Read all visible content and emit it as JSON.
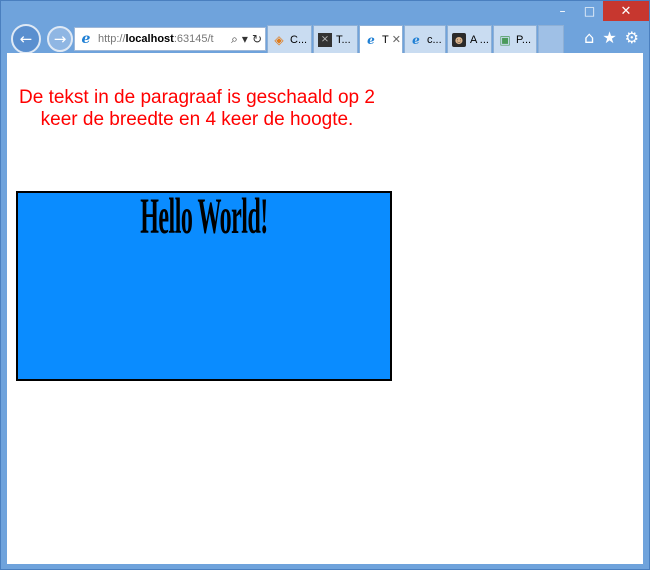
{
  "window": {
    "minimize": "–",
    "maximize": "□",
    "close": "✕"
  },
  "nav": {
    "back": "←",
    "forward": "→"
  },
  "address": {
    "prefix": "http://",
    "host": "localhost",
    "rest": ":63145/t"
  },
  "tabs": [
    {
      "label": "C...",
      "icon": "vs-icon"
    },
    {
      "label": "T...",
      "icon": "terminal-icon"
    },
    {
      "label": "T",
      "icon": "ie-icon",
      "active": true,
      "close": "✕"
    },
    {
      "label": "c...",
      "icon": "ie-icon"
    },
    {
      "label": "A ...",
      "icon": "avatar-icon"
    },
    {
      "label": "P...",
      "icon": "package-icon"
    }
  ],
  "page": {
    "paragraph": "De tekst in de paragraaf is geschaald op 2 keer de breedte en 4 keer de hoogte.",
    "hello": "Hello World!"
  },
  "colors": {
    "paragraph_text": "#ff0000",
    "box_fill": "#0a8cff",
    "frame": "#6fa3dc"
  }
}
